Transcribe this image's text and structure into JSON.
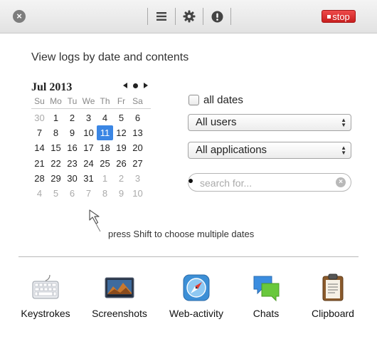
{
  "toolbar": {
    "close_glyph": "×",
    "buttons": [
      {
        "name": "list-icon"
      },
      {
        "name": "gear-icon"
      },
      {
        "name": "alert-icon"
      }
    ],
    "stop_label": "stop",
    "stop_color": "#d42a2a"
  },
  "heading": "View logs by date and contents",
  "calendar": {
    "month_label": "Jul 2013",
    "weekdays": [
      "Su",
      "Mo",
      "Tu",
      "We",
      "Th",
      "Fr",
      "Sa"
    ],
    "selected_day": "11",
    "selected_color": "#3b86e4",
    "weeks": [
      [
        [
          "30",
          true
        ],
        [
          "1",
          false
        ],
        [
          "2",
          false
        ],
        [
          "3",
          false
        ],
        [
          "4",
          false
        ],
        [
          "5",
          false
        ],
        [
          "6",
          false
        ]
      ],
      [
        [
          "7",
          false
        ],
        [
          "8",
          false
        ],
        [
          "9",
          false
        ],
        [
          "10",
          false
        ],
        [
          "11",
          false
        ],
        [
          "12",
          false
        ],
        [
          "13",
          false
        ]
      ],
      [
        [
          "14",
          false
        ],
        [
          "15",
          false
        ],
        [
          "16",
          false
        ],
        [
          "17",
          false
        ],
        [
          "18",
          false
        ],
        [
          "19",
          false
        ],
        [
          "20",
          false
        ]
      ],
      [
        [
          "21",
          false
        ],
        [
          "22",
          false
        ],
        [
          "23",
          false
        ],
        [
          "24",
          false
        ],
        [
          "25",
          false
        ],
        [
          "26",
          false
        ],
        [
          "27",
          false
        ]
      ],
      [
        [
          "28",
          false
        ],
        [
          "29",
          false
        ],
        [
          "30",
          false
        ],
        [
          "31",
          false
        ],
        [
          "1",
          true
        ],
        [
          "2",
          true
        ],
        [
          "3",
          true
        ]
      ],
      [
        [
          "4",
          true
        ],
        [
          "5",
          true
        ],
        [
          "6",
          true
        ],
        [
          "7",
          true
        ],
        [
          "8",
          true
        ],
        [
          "9",
          true
        ],
        [
          "10",
          true
        ]
      ]
    ]
  },
  "hint": "press Shift to choose multiple dates",
  "filters": {
    "all_dates_label": "all dates",
    "all_dates_checked": false,
    "users_selected": "All users",
    "apps_selected": "All applications",
    "search_placeholder": "search for...",
    "search_value": ""
  },
  "tools": [
    {
      "label": "Keystrokes",
      "icon": "keyboard-icon"
    },
    {
      "label": "Screenshots",
      "icon": "screenshot-icon"
    },
    {
      "label": "Web-activity",
      "icon": "compass-icon"
    },
    {
      "label": "Chats",
      "icon": "chat-bubbles-icon"
    },
    {
      "label": "Clipboard",
      "icon": "clipboard-icon"
    }
  ]
}
